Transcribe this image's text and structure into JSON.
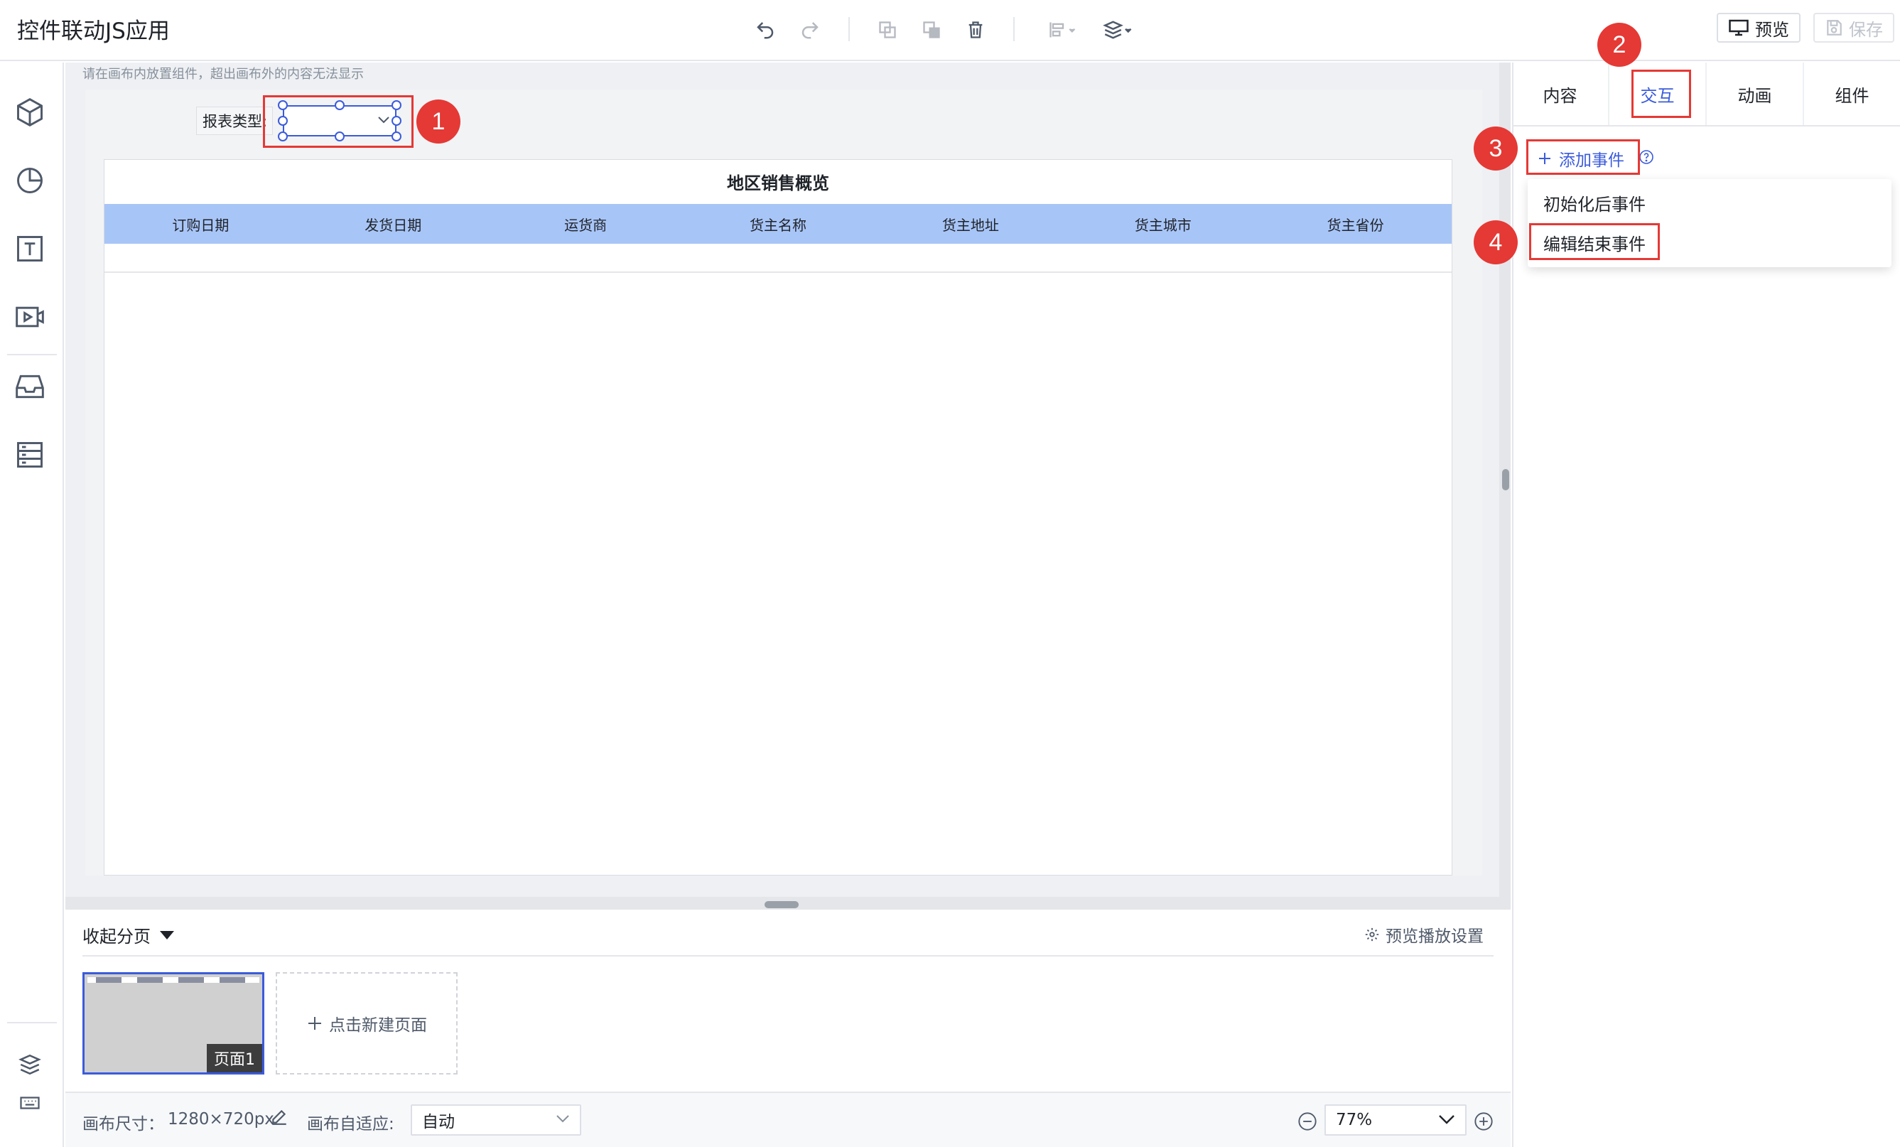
{
  "app": {
    "title": "控件联动JS应用"
  },
  "toolbar": {
    "icons": [
      "undo-icon",
      "redo-icon",
      "copy-icon",
      "paste-icon",
      "delete-icon",
      "align-icon",
      "layers-stack-icon"
    ],
    "preview_label": "预览",
    "save_label": "保存"
  },
  "left_rail": {
    "icons": [
      "cube-icon",
      "pie-chart-icon",
      "text-icon",
      "video-icon",
      "inbox-icon",
      "server-list-icon",
      "layers-icon",
      "keyboard-icon"
    ]
  },
  "canvas": {
    "hint": "请在画布内放置组件，超出画布外的内容无法显示",
    "filter_label": "报表类型:",
    "table": {
      "title": "地区销售概览",
      "columns": [
        "订购日期",
        "发货日期",
        "运货商",
        "货主名称",
        "货主地址",
        "货主城市",
        "货主省份"
      ]
    }
  },
  "callouts": [
    "1",
    "2",
    "3",
    "4"
  ],
  "right_panel": {
    "tabs": [
      "内容",
      "交互",
      "动画",
      "组件"
    ],
    "active_tab": "交互",
    "add_event_label": "添加事件",
    "event_menu": [
      "初始化后事件",
      "编辑结束事件"
    ]
  },
  "pages": {
    "collapse_label": "收起分页",
    "play_settings_label": "预览播放设置",
    "page_label": "页面1",
    "new_page_label": "点击新建页面"
  },
  "status": {
    "canvas_size_label": "画布尺寸：",
    "canvas_size_value": "1280×720px",
    "adapt_label": "画布自适应:",
    "adapt_value": "自动",
    "zoom_value": "77%"
  },
  "colors": {
    "accent": "#3b5bdb",
    "callout": "#e53935",
    "table_header": "#a8c5f7"
  }
}
